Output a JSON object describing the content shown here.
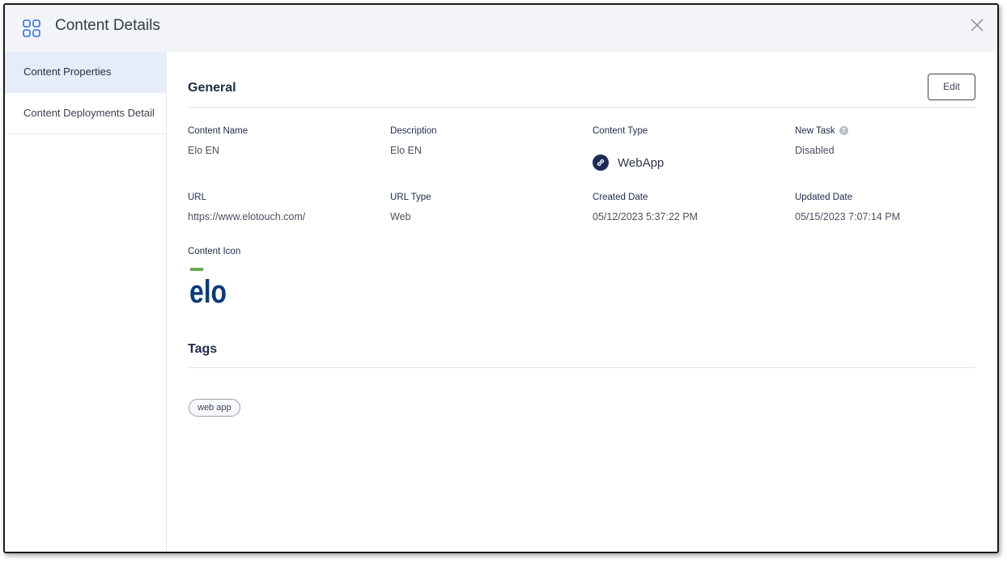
{
  "header": {
    "title": "Content Details",
    "app_icon": "grid-icon",
    "close_icon": "close-icon"
  },
  "sidebar": {
    "items": [
      {
        "label": "Content Properties",
        "active": true
      },
      {
        "label": "Content Deployments Detail",
        "active": false
      }
    ]
  },
  "general": {
    "title": "General",
    "edit_label": "Edit",
    "fields": {
      "content_name": {
        "label": "Content Name",
        "value": "Elo EN"
      },
      "description": {
        "label": "Description",
        "value": "Elo EN"
      },
      "content_type": {
        "label": "Content Type",
        "value": "WebApp",
        "icon": "link-icon"
      },
      "new_task": {
        "label": "New Task",
        "value": "Disabled",
        "help_glyph": "?"
      },
      "url": {
        "label": "URL",
        "value": "https://www.elotouch.com/"
      },
      "url_type": {
        "label": "URL Type",
        "value": "Web"
      },
      "created_date": {
        "label": "Created Date",
        "value": "05/12/2023 5:37:22 PM"
      },
      "updated_date": {
        "label": "Updated Date",
        "value": "05/15/2023 7:07:14 PM"
      },
      "content_icon": {
        "label": "Content Icon",
        "logo_text": "elo"
      }
    }
  },
  "tags": {
    "title": "Tags",
    "items": [
      "web app"
    ]
  },
  "colors": {
    "accent": "#2f6fe0",
    "heading": "#1e2b4a",
    "link_badge": "#1c2c56",
    "elo_blue": "#0a3a7a",
    "elo_green": "#6aa84f",
    "sidebar_active": "#e6ecf9"
  }
}
